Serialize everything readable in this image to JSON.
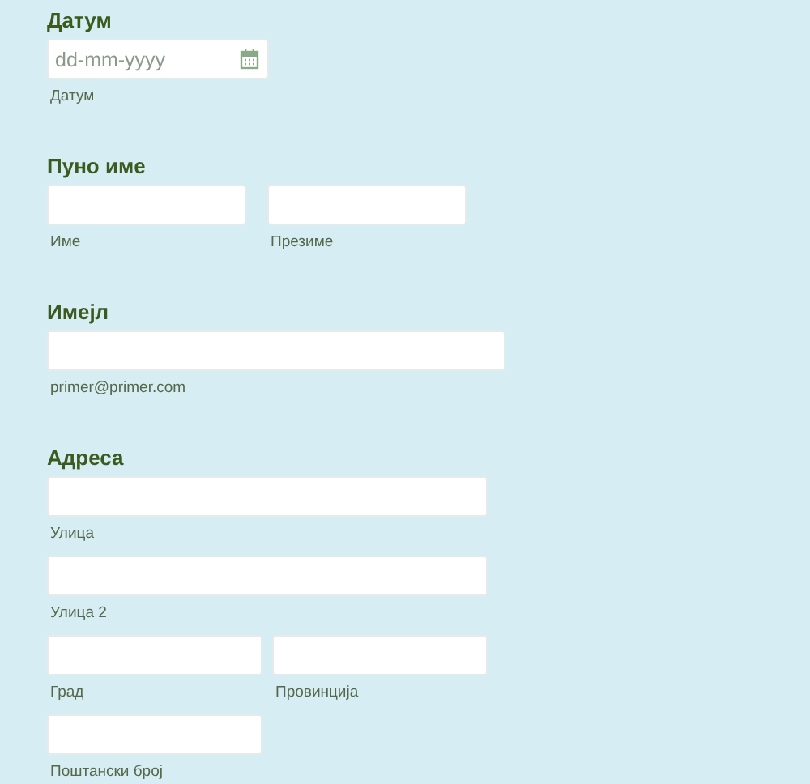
{
  "sections": [
    {
      "title": "Датум",
      "rows": [
        [
          {
            "kind": "date",
            "placeholder": "dd-mm-yyyy",
            "sublabel": "Датум"
          }
        ]
      ]
    },
    {
      "title": "Пуно име",
      "rows": [
        [
          {
            "kind": "name",
            "sublabel": "Име"
          },
          {
            "kind": "name",
            "sublabel": "Презиме"
          }
        ]
      ]
    },
    {
      "title": "Имејл",
      "rows": [
        [
          {
            "kind": "email",
            "sublabel": "primer@primer.com"
          }
        ]
      ]
    },
    {
      "title": "Адреса",
      "rows": [
        [
          {
            "kind": "street",
            "sublabel": "Улица"
          }
        ],
        [
          {
            "kind": "street",
            "sublabel": "Улица 2"
          }
        ],
        [
          {
            "kind": "city",
            "sublabel": "Град"
          },
          {
            "kind": "city",
            "sublabel": "Провинција"
          }
        ],
        [
          {
            "kind": "city",
            "sublabel": "Поштански број"
          }
        ]
      ]
    }
  ]
}
